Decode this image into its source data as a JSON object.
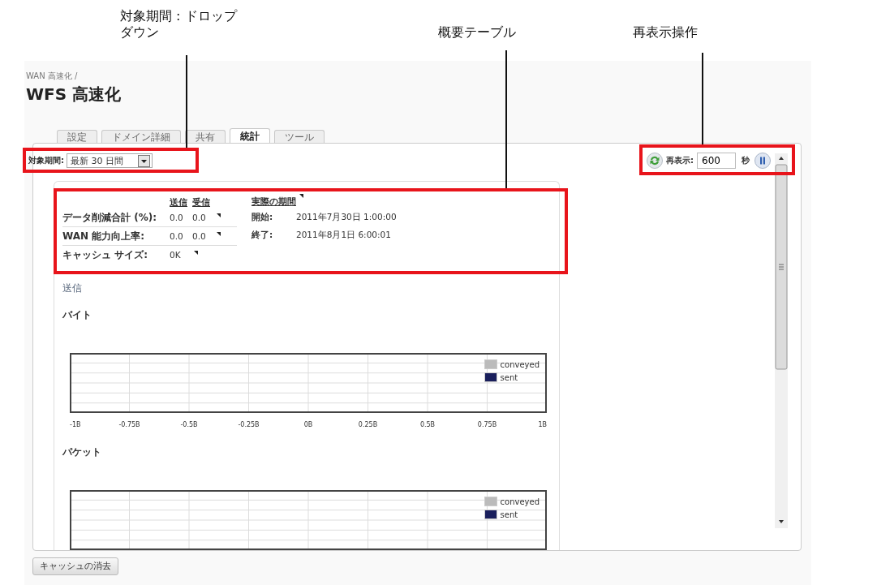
{
  "callouts": [
    {
      "text": "対象期間 : ドロップダウン"
    },
    {
      "text": "概要テーブル"
    },
    {
      "text": "再表示操作"
    }
  ],
  "breadcrumb": "WAN 高速化 /",
  "title": "WFS 高速化",
  "tabs": [
    {
      "label": "設定",
      "selected": false
    },
    {
      "label": "ドメイン詳細",
      "selected": false
    },
    {
      "label": "共有",
      "selected": false
    },
    {
      "label": "統計",
      "selected": true
    },
    {
      "label": "ツール",
      "selected": false
    }
  ],
  "period": {
    "label": "対象期間:",
    "value": "最新 30 日間"
  },
  "refresh": {
    "label": "再表示:",
    "value": "600",
    "unit": "秒"
  },
  "summary": {
    "columns": [
      "送信",
      "受信"
    ],
    "period_heading": "実際の期間",
    "rows": [
      {
        "label": "データ削減合計 (%):",
        "values": [
          "0.0",
          "0.0"
        ]
      },
      {
        "label": "WAN 能力向上率:",
        "values": [
          "0.0",
          "0.0"
        ]
      },
      {
        "label": "キャッシュ サイズ:",
        "values": [
          "0K"
        ]
      }
    ],
    "period_rows": [
      {
        "label": "開始:",
        "value": "2011年7月30日 1:00:00"
      },
      {
        "label": "終了:",
        "value": "2011年8月1日 6:00:01"
      }
    ]
  },
  "section": "送信",
  "charts": [
    {
      "title": "バイト",
      "axis_labels": [
        "-1B",
        "-0.75B",
        "-0.5B",
        "-0.25B",
        "0B",
        "0.25B",
        "0.5B",
        "0.75B",
        "1B"
      ],
      "legend": [
        {
          "name": "conveyed",
          "color": "#bbbbbb"
        },
        {
          "name": "sent",
          "color": "#1a1f5c"
        }
      ]
    },
    {
      "title": "パケット",
      "legend": [
        {
          "name": "conveyed",
          "color": "#bbbbbb"
        },
        {
          "name": "sent",
          "color": "#1a1f5c"
        }
      ]
    }
  ],
  "clear_button": "キャッシュの消去"
}
